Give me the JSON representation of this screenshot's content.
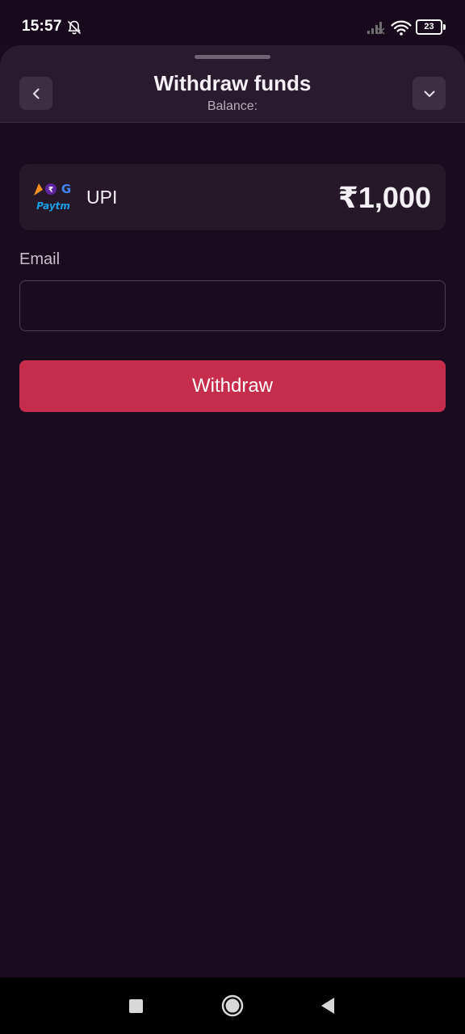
{
  "status_bar": {
    "time": "15:57",
    "battery": "23",
    "icons": [
      "bell-off-icon",
      "signal-icon",
      "wifi-icon",
      "battery-icon"
    ]
  },
  "header": {
    "title": "Withdraw funds",
    "subtitle": "Balance:",
    "back_icon": "chevron-left-icon",
    "collapse_icon": "chevron-down-icon"
  },
  "method": {
    "name": "UPI",
    "amount": "₹1,000",
    "logo_text": "Paytm"
  },
  "email": {
    "label": "Email",
    "value": "",
    "placeholder": ""
  },
  "withdraw": {
    "label": "Withdraw"
  },
  "colors": {
    "background": "#1a0b1e",
    "header": "#2a1a2e",
    "card": "#261829",
    "accent": "#c62d4c"
  },
  "nav": {
    "icons": [
      "recent-apps-icon",
      "home-icon",
      "back-icon"
    ]
  }
}
